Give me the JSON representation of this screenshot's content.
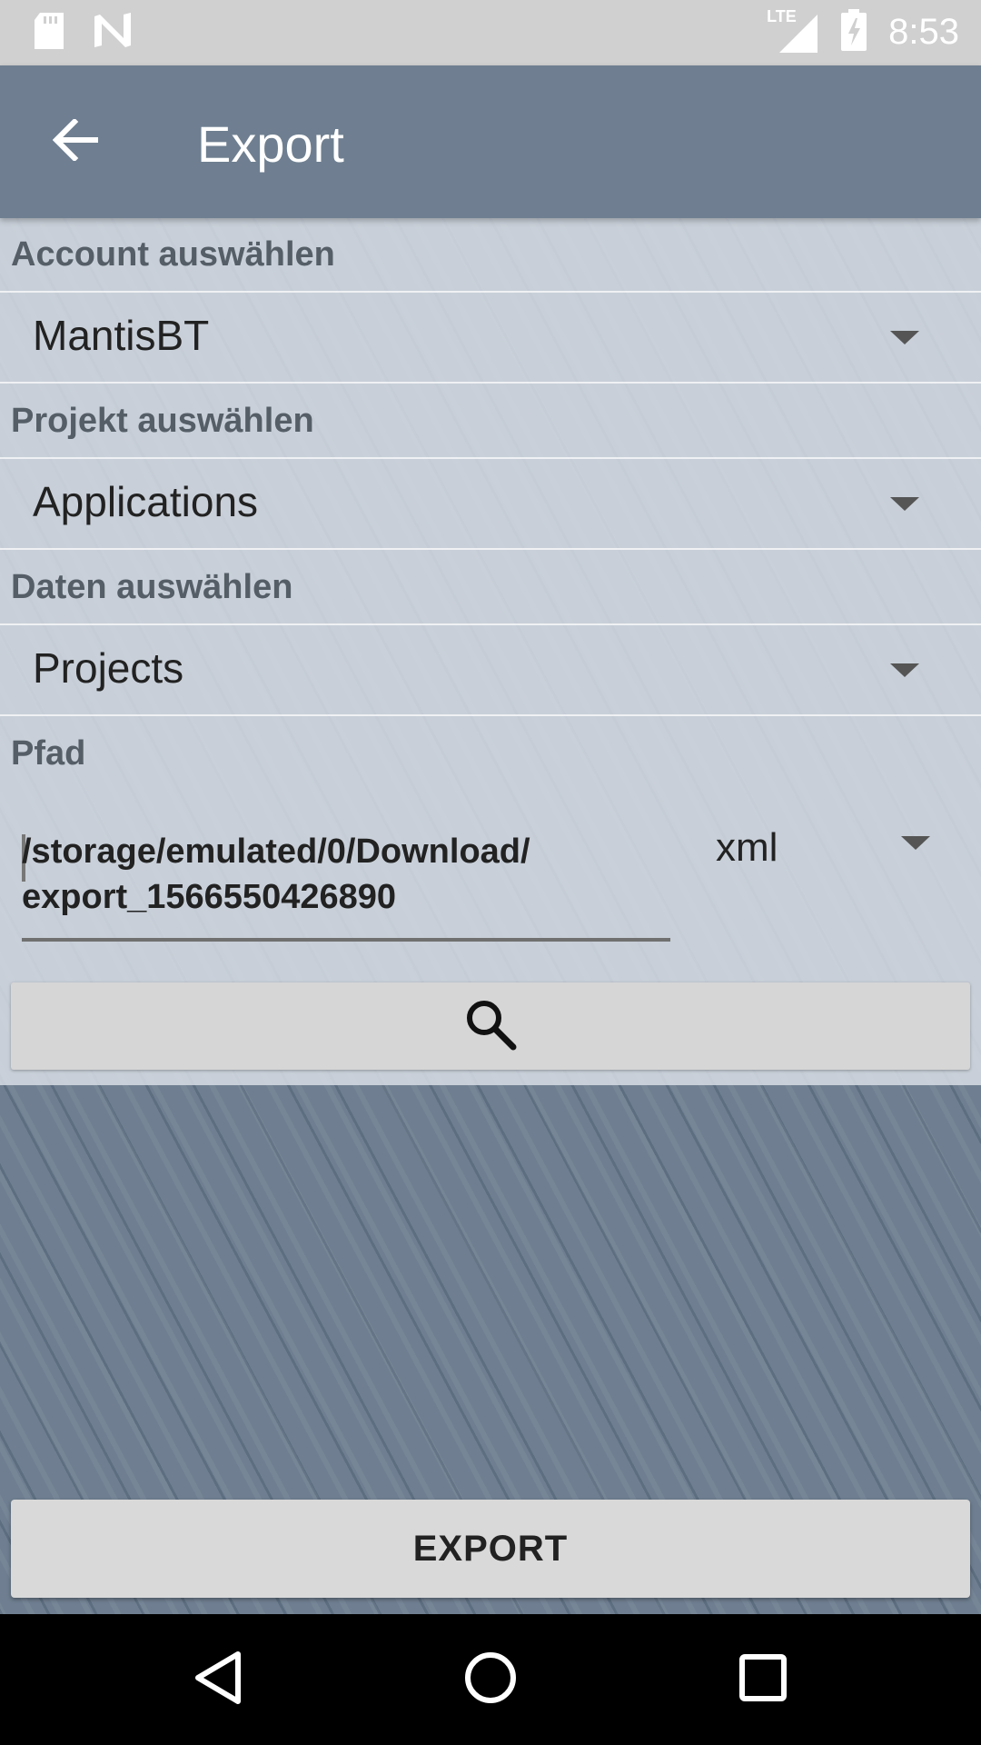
{
  "status_bar": {
    "time": "8:53",
    "network_label": "LTE",
    "icons": [
      "sd-card-icon",
      "n-notification-icon",
      "lte-signal-icon",
      "battery-charging-icon"
    ]
  },
  "app_bar": {
    "title": "Export",
    "back_icon": "arrow-back-icon"
  },
  "form": {
    "account": {
      "label": "Account auswählen",
      "value": "MantisBT"
    },
    "project": {
      "label": "Projekt auswählen",
      "value": "Applications"
    },
    "data": {
      "label": "Daten auswählen",
      "value": "Projects"
    },
    "path": {
      "label": "Pfad",
      "value": "/storage/emulated/0/Download/\nexport_1566550426890",
      "format": "xml"
    },
    "search_icon": "search-icon"
  },
  "export_button": {
    "label": "EXPORT"
  },
  "nav_bar": {
    "icons": [
      "back-triangle-icon",
      "home-circle-icon",
      "recents-square-icon"
    ]
  },
  "colors": {
    "app_bar": "#6f7f91",
    "status_bar": "#d0d0d0",
    "panel": "#d6dce4"
  }
}
